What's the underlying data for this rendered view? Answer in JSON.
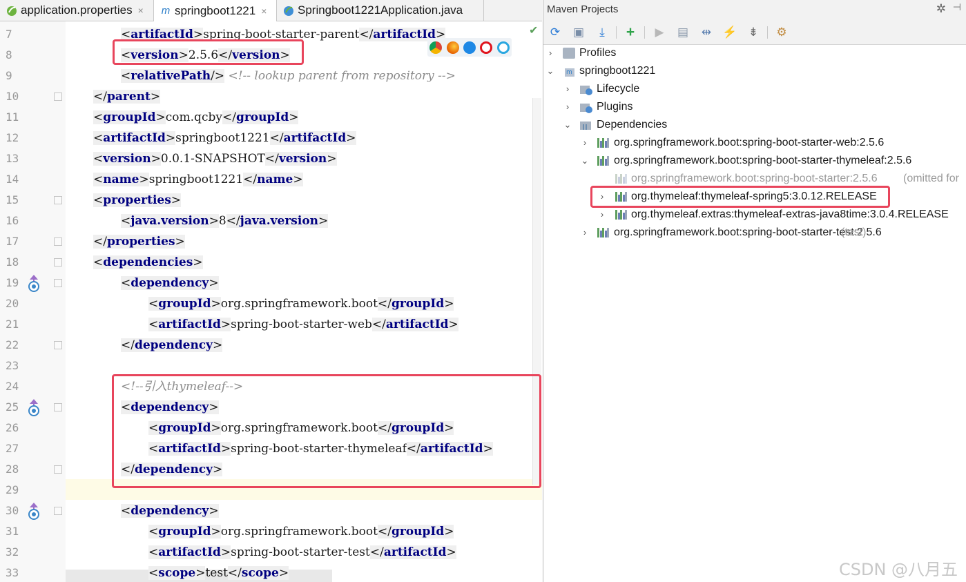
{
  "tabs": [
    {
      "label": "application.properties",
      "close": "×"
    },
    {
      "label": "springboot1221",
      "close": "×",
      "icon_text": "m"
    },
    {
      "label": "Springboot1221Application.java",
      "close": ""
    }
  ],
  "editor": {
    "line_numbers": [
      "7",
      "8",
      "9",
      "10",
      "11",
      "12",
      "13",
      "14",
      "15",
      "16",
      "17",
      "18",
      "19",
      "20",
      "21",
      "22",
      "23",
      "24",
      "25",
      "26",
      "27",
      "28",
      "29",
      "30",
      "31",
      "32",
      "33"
    ],
    "lines": {
      "l7": {
        "open": "artifactId",
        "text": "spring-boot-starter-parent",
        "close": "artifactId"
      },
      "l8": {
        "open": "version",
        "text": "2.5.6",
        "close": "version"
      },
      "l9": {
        "tag": "relativePath",
        "comment": "<!-- lookup parent from repository -->"
      },
      "l10": {
        "close": "parent"
      },
      "l11": {
        "open": "groupId",
        "text": "com.qcby",
        "close": "groupId"
      },
      "l12": {
        "open": "artifactId",
        "text": "springboot1221",
        "close": "artifactId"
      },
      "l13": {
        "open": "version",
        "text": "0.0.1-SNAPSHOT",
        "close": "version"
      },
      "l14": {
        "open": "name",
        "text": "springboot1221",
        "close": "name"
      },
      "l15": {
        "open": "properties"
      },
      "l16": {
        "open": "java.version",
        "text": "8",
        "close": "java.version"
      },
      "l17": {
        "close": "properties"
      },
      "l18": {
        "open": "dependencies"
      },
      "l19": {
        "open": "dependency"
      },
      "l20": {
        "open": "groupId",
        "text": "org.springframework.boot",
        "close": "groupId"
      },
      "l21": {
        "open": "artifactId",
        "text": "spring-boot-starter-web",
        "close": "artifactId"
      },
      "l22": {
        "close": "dependency"
      },
      "l24": {
        "comment": "<!--引入thymeleaf-->"
      },
      "l25": {
        "open": "dependency"
      },
      "l26": {
        "open": "groupId",
        "text": "org.springframework.boot",
        "close": "groupId"
      },
      "l27": {
        "open": "artifactId",
        "text": "spring-boot-starter-thymeleaf",
        "close": "artifactId"
      },
      "l28": {
        "close": "dependency"
      },
      "l30": {
        "open": "dependency"
      },
      "l31": {
        "open": "groupId",
        "text": "org.springframework.boot",
        "close": "groupId"
      },
      "l32": {
        "open": "artifactId",
        "text": "spring-boot-starter-test",
        "close": "artifactId"
      },
      "l33": {
        "open": "scope",
        "text": "test",
        "close": "scope"
      }
    }
  },
  "maven": {
    "title": "Maven Projects",
    "gear": "✲",
    "hide": "⊣",
    "toolbar": [
      "refresh-icon",
      "generate-sources-icon",
      "download-icon",
      "add-icon",
      "run-icon",
      "execute-goal-icon",
      "toggle-offline-icon",
      "skip-tests-icon",
      "collapse-all-icon",
      "settings-icon"
    ],
    "tree": {
      "profiles": "Profiles",
      "project": "springboot1221",
      "lifecycle": "Lifecycle",
      "plugins": "Plugins",
      "dependencies": "Dependencies",
      "dep_web": "org.springframework.boot:spring-boot-starter-web:2.5.6",
      "dep_thymeleaf": "org.springframework.boot:spring-boot-starter-thymeleaf:2.5.6",
      "dep_starter": "org.springframework.boot:spring-boot-starter:2.5.6",
      "dep_starter_note": "(omitted for",
      "dep_spring5": "org.thymeleaf:thymeleaf-spring5:3.0.12.RELEASE",
      "dep_java8time": "org.thymeleaf.extras:thymeleaf-extras-java8time:3.0.4.RELEASE",
      "dep_test": "org.springframework.boot:spring-boot-starter-test:2.5.6",
      "dep_test_note": "(test)"
    }
  },
  "watermark": "CSDN @八月五"
}
